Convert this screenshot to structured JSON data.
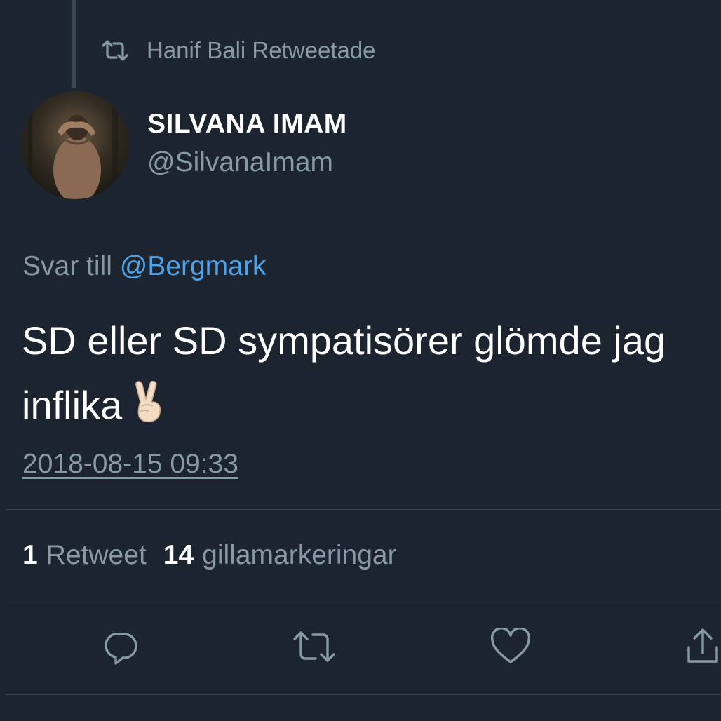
{
  "retweet_notice": {
    "text": "Hanif Bali Retweetade",
    "icon": "retweet-icon"
  },
  "author": {
    "display_name": "SILVANA IMAM",
    "handle": "@SilvanaImam",
    "avatar": "avatar-photo"
  },
  "reply": {
    "prefix": "Svar till",
    "mention": "@Bergmark"
  },
  "tweet": {
    "line1": "SD eller SD sympatisörer glömde jag",
    "line2": "inflika",
    "emoji": "victory-hand-emoji",
    "timestamp": "2018-08-15 09:33"
  },
  "stats": {
    "retweets_count": "1",
    "retweets_label": "Retweet",
    "likes_count": "14",
    "likes_label": "gillamarkeringar"
  },
  "actions": [
    {
      "name": "reply",
      "icon": "reply-icon"
    },
    {
      "name": "retweet",
      "icon": "retweet-icon"
    },
    {
      "name": "like",
      "icon": "heart-icon"
    },
    {
      "name": "share",
      "icon": "share-icon"
    }
  ],
  "colors": {
    "background": "#1c2430",
    "secondary_text": "#8899a6",
    "link": "#4aa3ec",
    "divider": "#38444d"
  }
}
